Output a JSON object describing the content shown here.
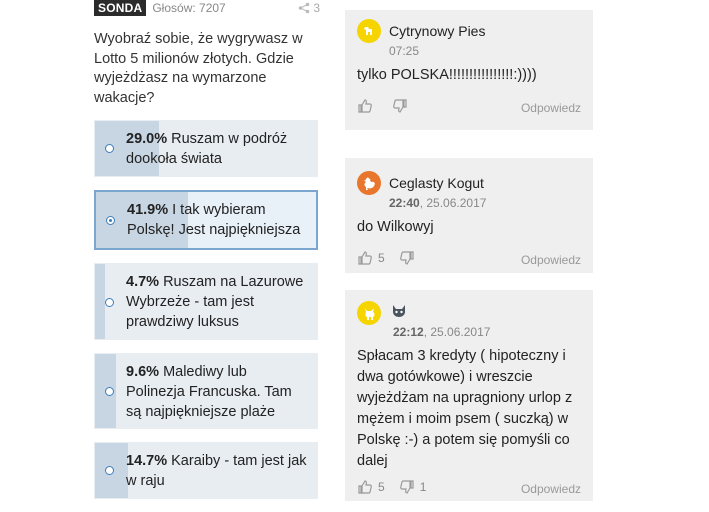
{
  "poll": {
    "badge": "SONDA",
    "votes": "Głosów: 7207",
    "share_count": "3",
    "question": "Wyobraź sobie, że wygrywasz w Lotto 5 milionów złotych. Gdzie wyjeżdżasz na wymarzone wakacje?",
    "options": [
      {
        "percent": "29.0%",
        "text": "Ruszam w podróż dookoła świata",
        "share": 0.29,
        "selected": false
      },
      {
        "percent": "41.9%",
        "text": "I tak wybieram Polskę! Jest najpiękniejsza",
        "share": 0.419,
        "selected": true
      },
      {
        "percent": "4.7%",
        "text": "Ruszam na Lazurowe Wybrzeże - tam jest prawdziwy luksus",
        "share": 0.047,
        "selected": false
      },
      {
        "percent": "9.6%",
        "text": "Malediwy lub Polinezja Francuska. Tam są najpiękniejsze plaże",
        "share": 0.096,
        "selected": false
      },
      {
        "percent": "14.7%",
        "text": "Karaiby - tam jest jak w raju",
        "share": 0.147,
        "selected": false
      }
    ]
  },
  "comments": [
    {
      "author": "Cytrynowy Pies",
      "time": "07:25",
      "date": "",
      "text": "tylko POLSKA!!!!!!!!!!!!!!!!:))))",
      "likes": "",
      "dislikes": "",
      "reply": "Odpowiedz",
      "avatar_color": "#f5d400",
      "avatar_icon": "dog-icon"
    },
    {
      "author": "Ceglasty Kogut",
      "time": "22:40",
      "date": ", 25.06.2017",
      "text": "do Wilkowyj",
      "likes": "5",
      "dislikes": "",
      "reply": "Odpowiedz",
      "avatar_color": "#e8762c",
      "avatar_icon": "rooster-icon"
    },
    {
      "author": "",
      "time": "22:12",
      "date": ", 25.06.2017",
      "text": "Spłacam 3 kredyty ( hipoteczny i dwa gotówkowe) i wreszcie wyjeżdżam na upragniony urlop z mężem i moim psem ( suczką) w Polskę :-) a potem się pomyśli co dalej",
      "likes": "5",
      "dislikes": "1",
      "reply": "Odpowiedz",
      "avatar_color": "#f5d400",
      "avatar_icon": "goat-icon"
    }
  ]
}
